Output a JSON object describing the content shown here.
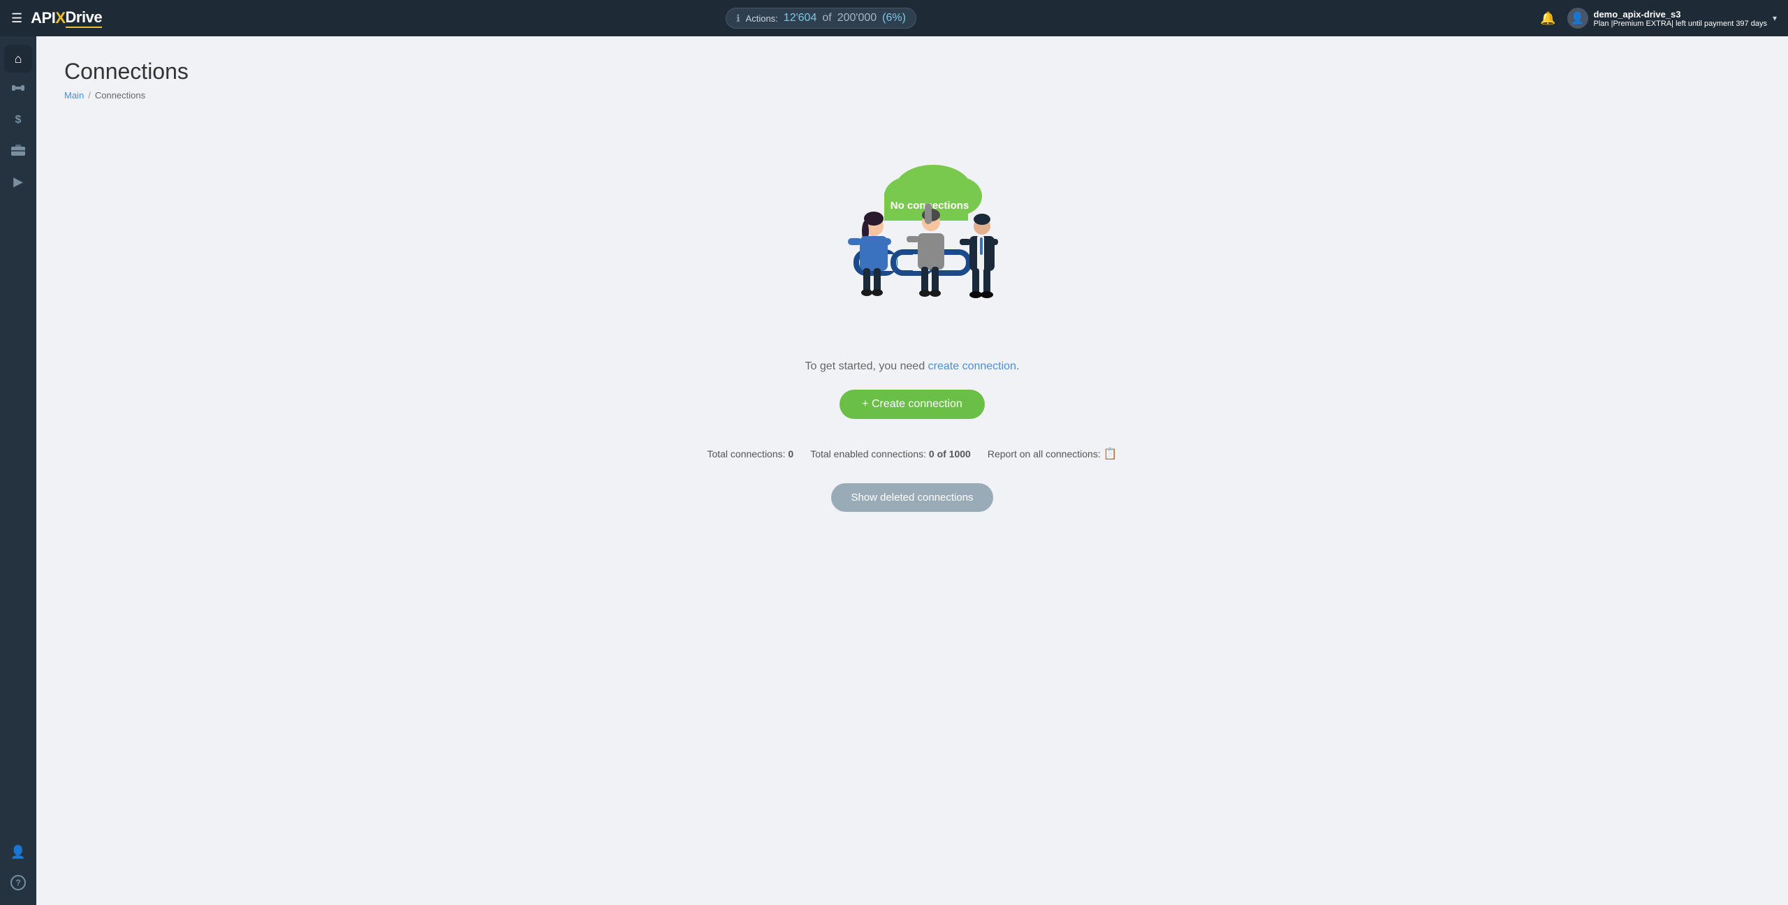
{
  "header": {
    "menu_icon": "☰",
    "logo_api": "API",
    "logo_x": "X",
    "logo_drive": "Drive",
    "actions_label": "Actions:",
    "actions_count": "12'604",
    "actions_of": "of",
    "actions_total": "200'000",
    "actions_pct": "(6%)",
    "user_name": "demo_apix-drive_s3",
    "user_plan_label": "Plan |Premium EXTRA| left until payment",
    "user_plan_days": "397 days",
    "chevron": "▾"
  },
  "sidebar": {
    "items": [
      {
        "name": "home",
        "icon": "⌂"
      },
      {
        "name": "sitemap",
        "icon": "⊞"
      },
      {
        "name": "dollar",
        "icon": "$"
      },
      {
        "name": "briefcase",
        "icon": "🗂"
      },
      {
        "name": "play",
        "icon": "▶"
      },
      {
        "name": "user",
        "icon": "👤"
      },
      {
        "name": "help",
        "icon": "?"
      }
    ]
  },
  "page": {
    "title": "Connections",
    "breadcrumb_home": "Main",
    "breadcrumb_sep": "/",
    "breadcrumb_current": "Connections"
  },
  "empty_state": {
    "cloud_label": "No connections",
    "message_before": "To get started, you need",
    "message_link": "create connection",
    "message_after": ".",
    "create_btn": "+ Create connection",
    "total_connections_label": "Total connections:",
    "total_connections_value": "0",
    "total_enabled_label": "Total enabled connections:",
    "total_enabled_value": "0 of 1000",
    "report_label": "Report on all connections:",
    "show_deleted_btn": "Show deleted connections"
  }
}
